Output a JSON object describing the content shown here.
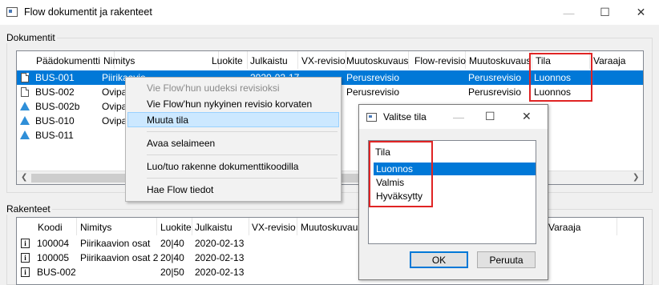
{
  "window": {
    "title": "Flow dokumentit ja rakenteet",
    "controls": {
      "minimize": "—",
      "maximize": "☐",
      "close": "✕"
    }
  },
  "documents": {
    "group_label": "Dokumentit",
    "columns": [
      "Päädokumentti",
      "Nimitys",
      "Luokite",
      "Julkaistu",
      "VX-revisio",
      "Muutoskuvaus",
      "Flow-revisio",
      "Muutoskuvaus",
      "Tila",
      "Varaaja"
    ],
    "rows": [
      {
        "icon": "document-icon",
        "main": "BUS-001",
        "name": "Piirikaavio",
        "published": "2020-02-17",
        "change": "Perusrevisio",
        "change2": "Perusrevisio",
        "state": "Luonnos",
        "selected": true
      },
      {
        "icon": "document-icon",
        "main": "BUS-002",
        "name": "Ovipa",
        "published": "",
        "change": "Perusrevisio",
        "change2": "Perusrevisio",
        "state": "Luonnos",
        "selected": false
      },
      {
        "icon": "assembly-icon",
        "main": "BUS-002b",
        "name": "Ovipa",
        "published": "",
        "change": "",
        "change2": "",
        "state": "",
        "selected": false
      },
      {
        "icon": "assembly-icon",
        "main": "BUS-010",
        "name": "Ovipa",
        "published": "",
        "change": "",
        "change2": "",
        "state": "",
        "selected": false
      },
      {
        "icon": "assembly-icon",
        "main": "BUS-011",
        "name": "",
        "published": "",
        "change": "",
        "change2": "",
        "state": "",
        "selected": false
      }
    ]
  },
  "structures": {
    "group_label": "Rakenteet",
    "columns": [
      "Koodi",
      "Nimitys",
      "Luokite",
      "Julkaistu",
      "VX-revisio",
      "Muutoskuvaus",
      "Varaaja"
    ],
    "rows": [
      {
        "code": "100004",
        "name": "Piirikaavion osat",
        "class": "20|40",
        "published": "2020-02-13"
      },
      {
        "code": "100005",
        "name": "Piirikaavion osat 2",
        "class": "20|40",
        "published": "2020-02-13"
      },
      {
        "code": "BUS-002",
        "name": "",
        "class": "20|50",
        "published": "2020-02-13"
      }
    ]
  },
  "context_menu": {
    "items": [
      {
        "label": "Vie Flow'hun uudeksi revisioksi",
        "disabled": true
      },
      {
        "label": "Vie Flow'hun nykyinen revisio korvaten",
        "disabled": false
      },
      {
        "label": "Muuta tila",
        "disabled": false,
        "hover": true
      },
      {
        "label": "Avaa selaimeen",
        "disabled": false
      },
      {
        "label": "Luo/tuo rakenne dokumenttikoodilla",
        "disabled": false
      },
      {
        "label": "Hae Flow tiedot",
        "disabled": false
      }
    ]
  },
  "dialog": {
    "title": "Valitse tila",
    "list_header": "Tila",
    "options": [
      "Luonnos",
      "Valmis",
      "Hyväksytty"
    ],
    "selected_option": "Luonnos",
    "ok_label": "OK",
    "cancel_label": "Peruuta"
  },
  "colors": {
    "selection": "#0078d7",
    "highlight_frame": "#e02424",
    "menu_hover": "#cce8ff"
  }
}
